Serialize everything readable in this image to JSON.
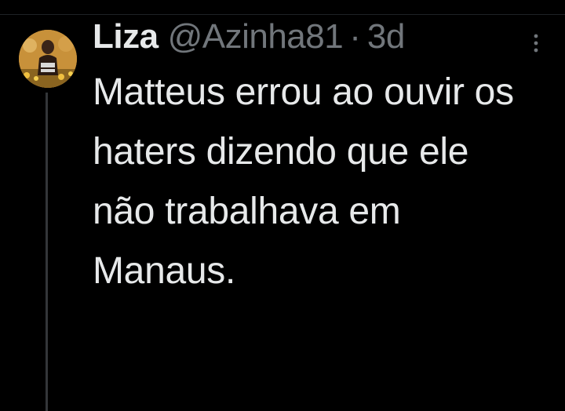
{
  "tweet": {
    "display_name": "Liza",
    "handle": "@Azinha81",
    "separator": "·",
    "timestamp": "3d",
    "text": "Matteus errou ao ouvir os haters dizendo que ele não trabalhava em Manaus."
  },
  "icons": {
    "more": "more-vertical-icon",
    "avatar": "avatar"
  },
  "colors": {
    "background": "#000000",
    "primary_text": "#e7e9ea",
    "secondary_text": "#71767b",
    "thread_line": "#333639"
  }
}
